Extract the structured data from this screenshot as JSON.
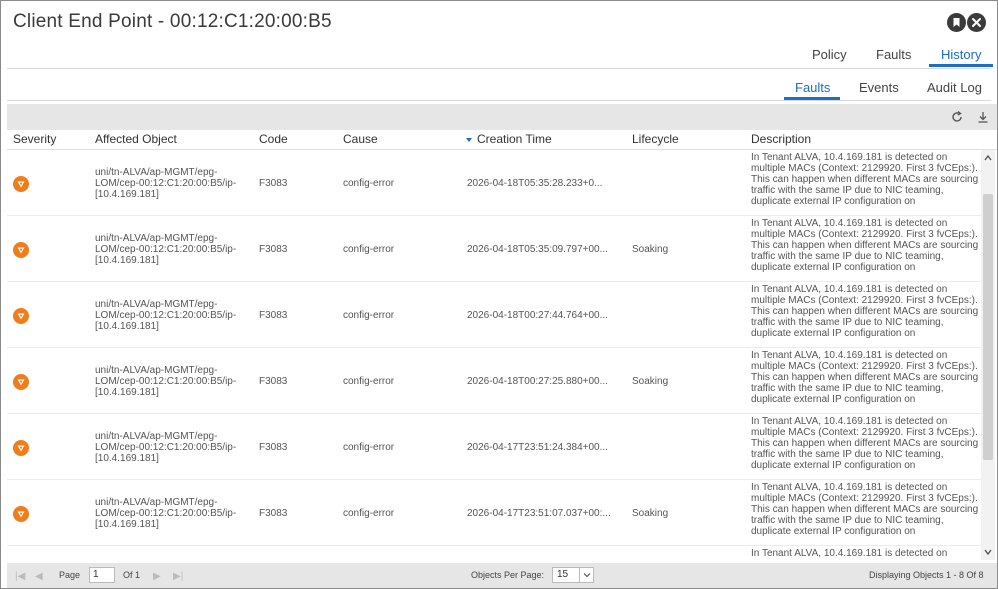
{
  "window": {
    "title": "Client End Point - 00:12:C1:20:00:B5",
    "pin_icon": "bookmark-icon",
    "close_icon": "close-icon"
  },
  "top_tabs": [
    {
      "label": "Policy",
      "active": false
    },
    {
      "label": "Faults",
      "active": false
    },
    {
      "label": "History",
      "active": true
    }
  ],
  "sub_tabs": [
    {
      "label": "Faults",
      "active": true
    },
    {
      "label": "Events",
      "active": false
    },
    {
      "label": "Audit Log",
      "active": false
    }
  ],
  "toolbar": {
    "refresh_icon": "refresh-icon",
    "download_icon": "download-icon"
  },
  "table": {
    "columns": [
      "Severity",
      "Affected Object",
      "Code",
      "Cause",
      "Creation Time",
      "Lifecycle",
      "Description"
    ],
    "sorted_column": "Creation Time",
    "severity_color": "#f07d1a",
    "rows": [
      {
        "severity": "warning",
        "affected_object": "uni/tn-ALVA/ap-MGMT/epg-LOM/cep-00:12:C1:20:00:B5/ip-[10.4.169.181]",
        "code": "F3083",
        "cause": "config-error",
        "creation_time": "2026-04-18T05:35:28.233+0...",
        "lifecycle": "",
        "description": "In Tenant ALVA, 10.4.169.181 is detected on multiple MACs (Context: 2129920. First 3 fvCEps:). This can happen when different MACs are sourcing traffic with the same IP due to NIC teaming, duplicate external IP configuration on"
      },
      {
        "severity": "warning",
        "affected_object": "uni/tn-ALVA/ap-MGMT/epg-LOM/cep-00:12:C1:20:00:B5/ip-[10.4.169.181]",
        "code": "F3083",
        "cause": "config-error",
        "creation_time": "2026-04-18T05:35:09.797+00...",
        "lifecycle": "Soaking",
        "description": "In Tenant ALVA, 10.4.169.181 is detected on multiple MACs (Context: 2129920. First 3 fvCEps:). This can happen when different MACs are sourcing traffic with the same IP due to NIC teaming, duplicate external IP configuration on"
      },
      {
        "severity": "warning",
        "affected_object": "uni/tn-ALVA/ap-MGMT/epg-LOM/cep-00:12:C1:20:00:B5/ip-[10.4.169.181]",
        "code": "F3083",
        "cause": "config-error",
        "creation_time": "2026-04-18T00:27:44.764+00...",
        "lifecycle": "",
        "description": "In Tenant ALVA, 10.4.169.181 is detected on multiple MACs (Context: 2129920. First 3 fvCEps:). This can happen when different MACs are sourcing traffic with the same IP due to NIC teaming, duplicate external IP configuration on"
      },
      {
        "severity": "warning",
        "affected_object": "uni/tn-ALVA/ap-MGMT/epg-LOM/cep-00:12:C1:20:00:B5/ip-[10.4.169.181]",
        "code": "F3083",
        "cause": "config-error",
        "creation_time": "2026-04-18T00:27:25.880+00...",
        "lifecycle": "Soaking",
        "description": "In Tenant ALVA, 10.4.169.181 is detected on multiple MACs (Context: 2129920. First 3 fvCEps:). This can happen when different MACs are sourcing traffic with the same IP due to NIC teaming, duplicate external IP configuration on"
      },
      {
        "severity": "warning",
        "affected_object": "uni/tn-ALVA/ap-MGMT/epg-LOM/cep-00:12:C1:20:00:B5/ip-[10.4.169.181]",
        "code": "F3083",
        "cause": "config-error",
        "creation_time": "2026-04-17T23:51:24.384+00...",
        "lifecycle": "",
        "description": "In Tenant ALVA, 10.4.169.181 is detected on multiple MACs (Context: 2129920. First 3 fvCEps:). This can happen when different MACs are sourcing traffic with the same IP due to NIC teaming, duplicate external IP configuration on"
      },
      {
        "severity": "warning",
        "affected_object": "uni/tn-ALVA/ap-MGMT/epg-LOM/cep-00:12:C1:20:00:B5/ip-[10.4.169.181]",
        "code": "F3083",
        "cause": "config-error",
        "creation_time": "2026-04-17T23:51:07.037+00:...",
        "lifecycle": "Soaking",
        "description": "In Tenant ALVA, 10.4.169.181 is detected on multiple MACs (Context: 2129920. First 3 fvCEps:). This can happen when different MACs are sourcing traffic with the same IP due to NIC teaming, duplicate external IP configuration on"
      },
      {
        "severity": "",
        "affected_object": "",
        "code": "",
        "cause": "",
        "creation_time": "",
        "lifecycle": "",
        "description": "In Tenant ALVA, 10.4.169.181 is detected on"
      }
    ]
  },
  "footer": {
    "page_label": "Page",
    "page_value": "1",
    "of_label": "Of 1",
    "per_page_label": "Objects Per Page:",
    "per_page_value": "15",
    "displaying": "Displaying Objects 1 - 8 Of 8"
  }
}
